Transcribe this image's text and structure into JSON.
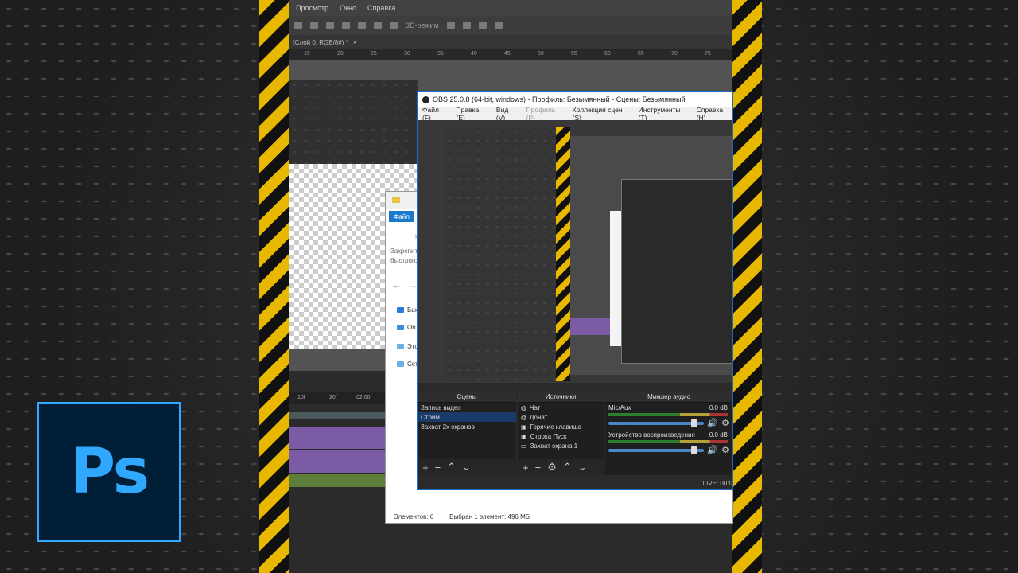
{
  "photoshop": {
    "menu": [
      "Просмотр",
      "Окно",
      "Справка"
    ],
    "options_mode": "3D-режим",
    "doc_tab": "(Слой 0, RGB/8#) *",
    "ruler_ticks": [
      "15",
      "20",
      "25",
      "30",
      "35",
      "40",
      "45",
      "50",
      "55",
      "60",
      "65",
      "70",
      "75"
    ],
    "timeline_ticks": [
      "10f",
      "20f",
      "02:00f"
    ],
    "logo_text": "Ps",
    "logo_color": "#31a8ff"
  },
  "explorer": {
    "file_tab": "Файл",
    "pin_text_1": "Закрепить",
    "pin_text_2": "быстрого",
    "sidebar": [
      {
        "label": "Быс",
        "color": "#2b7bd4"
      },
      {
        "label": "On",
        "color": "#3a8ee0"
      },
      {
        "label": "Это",
        "color": "#6ab0e6"
      },
      {
        "label": "Сет",
        "color": "#6ab0e6"
      }
    ],
    "status_items": "Элементов: 6",
    "status_selected": "Выбран 1 элемент: 496 МБ"
  },
  "obs": {
    "title": "OBS 25.0.8 (64-bit, windows) - Профиль: Безымянный - Сцены: Безымянный",
    "menu": [
      {
        "label": "Файл (F)",
        "disabled": false
      },
      {
        "label": "Правка (E)",
        "disabled": false
      },
      {
        "label": "Вид (V)",
        "disabled": false
      },
      {
        "label": "Профиль (P)",
        "disabled": true
      },
      {
        "label": "Коллекция сцен (S)",
        "disabled": false
      },
      {
        "label": "Инструменты (T)",
        "disabled": false
      },
      {
        "label": "Справка (H)",
        "disabled": false
      }
    ],
    "scenes": {
      "title": "Сцены",
      "items": [
        "Запись видео",
        "Стрим",
        "Захват 2х экранов"
      ],
      "selected_index": 1
    },
    "sources": {
      "title": "Источники",
      "items": [
        "Чат",
        "Донат",
        "Горячие клавиша",
        "Строка Пуск",
        "Захват экрана 1"
      ]
    },
    "mixer": {
      "title": "Микшер аудио",
      "channels": [
        {
          "name": "Mic/Aux",
          "level": "0.0 dB"
        },
        {
          "name": "Устройство воспроизведения",
          "level": "0.0 dB"
        }
      ]
    },
    "status": "LIVE: 00:0"
  }
}
